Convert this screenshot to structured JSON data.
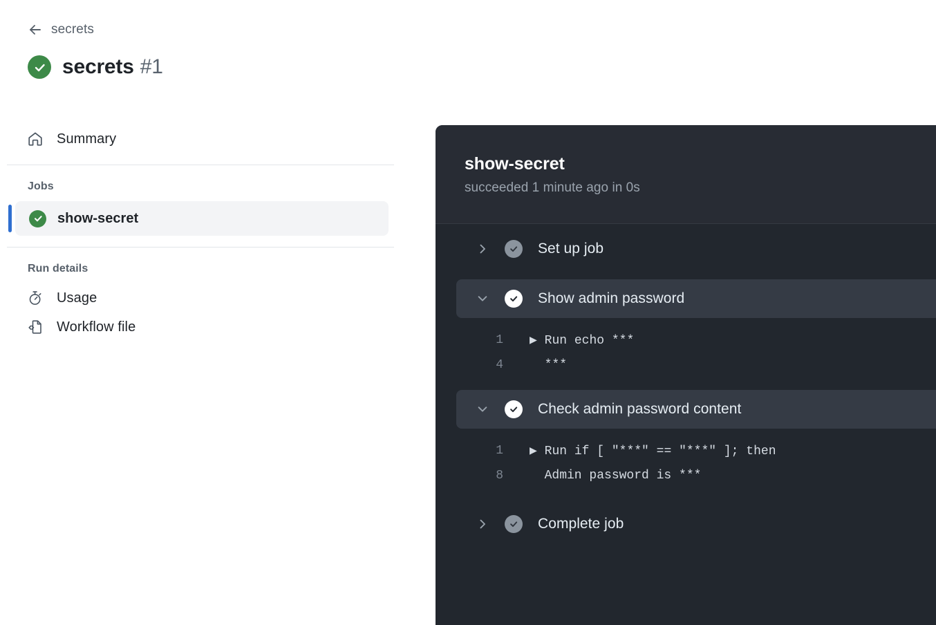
{
  "breadcrumb": {
    "icon": "arrow-left-icon",
    "label": "secrets"
  },
  "run_header": {
    "status_icon": "check-circle-icon",
    "status": "success",
    "title": "secrets",
    "number": "#1"
  },
  "sidebar": {
    "summary": {
      "icon": "home-icon",
      "label": "Summary"
    },
    "jobs_heading": "Jobs",
    "jobs": [
      {
        "name": "show-secret",
        "status": "success",
        "status_icon": "check-circle-icon",
        "selected": true
      }
    ],
    "run_details_heading": "Run details",
    "run_details": [
      {
        "icon": "stopwatch-icon",
        "label": "Usage"
      },
      {
        "icon": "file-code-icon",
        "label": "Workflow file"
      }
    ]
  },
  "log_panel": {
    "title": "show-secret",
    "subtitle": "succeeded 1 minute ago in 0s",
    "steps": [
      {
        "name": "Set up job",
        "expanded": false,
        "chevron": "chevron-right-icon",
        "status_icon": "check-circle-icon",
        "status": "success-dim",
        "lines": []
      },
      {
        "name": "Show admin password",
        "expanded": true,
        "chevron": "chevron-down-icon",
        "status_icon": "check-circle-icon",
        "status": "success",
        "lines": [
          {
            "number": "1",
            "text": "▶ Run echo ***"
          },
          {
            "number": "4",
            "text": "  ***"
          }
        ]
      },
      {
        "name": "Check admin password content",
        "expanded": true,
        "chevron": "chevron-down-icon",
        "status_icon": "check-circle-icon",
        "status": "success",
        "lines": [
          {
            "number": "1",
            "text": "▶ Run if [ \"***\" == \"***\" ]; then"
          },
          {
            "number": "8",
            "text": "  Admin password is ***"
          }
        ]
      },
      {
        "name": "Complete job",
        "expanded": false,
        "chevron": "chevron-right-icon",
        "status_icon": "check-circle-icon",
        "status": "success-dim",
        "lines": []
      }
    ]
  },
  "colors": {
    "success_green": "#3d8a48",
    "selection_blue": "#2f6fd0",
    "panel_bg": "#22272e",
    "panel_header_bg": "#282c34",
    "step_expanded_bg": "#353b45"
  }
}
